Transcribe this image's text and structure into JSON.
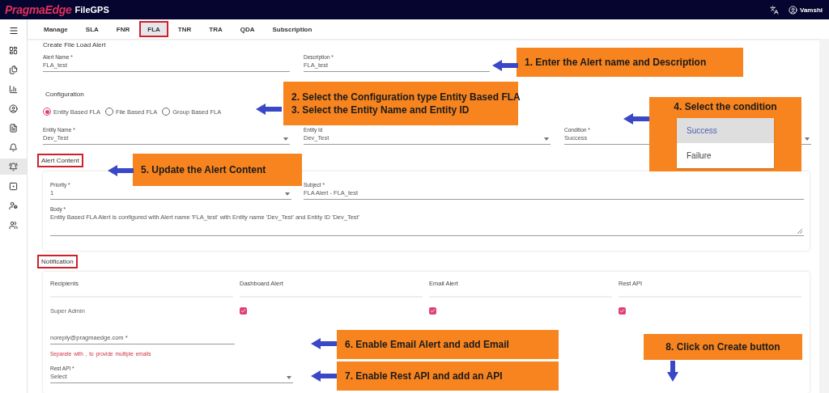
{
  "header": {
    "brand": "PragmaEdge",
    "product": "FileGPS",
    "user": "Vamshi"
  },
  "sidebar": {
    "items": [
      {
        "selected": false
      },
      {
        "selected": false
      },
      {
        "selected": false
      },
      {
        "selected": false
      },
      {
        "selected": false
      },
      {
        "selected": false
      },
      {
        "selected": true
      },
      {
        "selected": false
      },
      {
        "selected": false
      },
      {
        "selected": false
      }
    ]
  },
  "tabs": [
    {
      "label": "Manage",
      "selected": false,
      "annotated": false
    },
    {
      "label": "SLA",
      "selected": false,
      "annotated": false
    },
    {
      "label": "FNR",
      "selected": false,
      "annotated": false
    },
    {
      "label": "FLA",
      "selected": true,
      "annotated": true
    },
    {
      "label": "TNR",
      "selected": false,
      "annotated": false
    },
    {
      "label": "TRA",
      "selected": false,
      "annotated": false
    },
    {
      "label": "QDA",
      "selected": false,
      "annotated": false
    },
    {
      "label": "Subscription",
      "selected": false,
      "annotated": false
    }
  ],
  "form": {
    "title": "Create File Load Alert",
    "alert_name": {
      "label": "Alert Name *",
      "value": "FLA_test"
    },
    "description": {
      "label": "Description *",
      "value": "FLA_test"
    },
    "configuration": {
      "heading": "Configuration",
      "types": [
        {
          "label": "Entity Based FLA",
          "selected": true
        },
        {
          "label": "File Based FLA",
          "selected": false
        },
        {
          "label": "Group Based FLA",
          "selected": false
        }
      ]
    },
    "entity_name": {
      "label": "Entity Name *",
      "value": "Dev_Test"
    },
    "entity_id": {
      "label": "Entity Id",
      "value": "Dev_Test"
    },
    "condition": {
      "label": "Condition *",
      "value": "Success",
      "options": [
        {
          "label": "Success",
          "selected": true
        },
        {
          "label": "Failure",
          "selected": false
        }
      ]
    },
    "alert_content": {
      "heading": "Alert Content",
      "annotated": true,
      "priority": {
        "label": "Priority *",
        "value": "1"
      },
      "subject": {
        "label": "Subject *",
        "value": "FLA Alert - FLA_test"
      },
      "body": {
        "label": "Body *",
        "value": "Entity Based FLA Alert is configured with Alert name 'FLA_test' with Entity name 'Dev_Test' and Entity ID 'Dev_Test'"
      }
    },
    "notification": {
      "heading": "Notification",
      "annotated": true,
      "columns": [
        "Recipients",
        "Dashboard Alert",
        "Email Alert",
        "Rest API"
      ],
      "rows": [
        {
          "recipient": "Super Admin",
          "dashboard_alert": true,
          "email_alert": true,
          "rest_api": true
        }
      ],
      "email": {
        "value": "noreply@pragmaedge.com *",
        "helper": "Separate with , to provide multiple emails"
      },
      "rest_api": {
        "label": "Rest API *",
        "value": "Select"
      }
    }
  },
  "callouts": [
    {
      "lines": [
        "1. Enter the Alert name and Description"
      ]
    },
    {
      "lines": [
        "2. Select the Configuration type Entity Based FLA",
        "3. Select the Entity Name and Entity ID"
      ]
    },
    {
      "lines": [
        "4. Select the condition"
      ]
    },
    {
      "lines": [
        "5. Update the Alert Content"
      ]
    },
    {
      "lines": [
        "6. Enable Email Alert and add Email"
      ]
    },
    {
      "lines": [
        "7. Enable Rest API and add an API"
      ]
    },
    {
      "lines": [
        "8. Click on Create button"
      ]
    }
  ]
}
